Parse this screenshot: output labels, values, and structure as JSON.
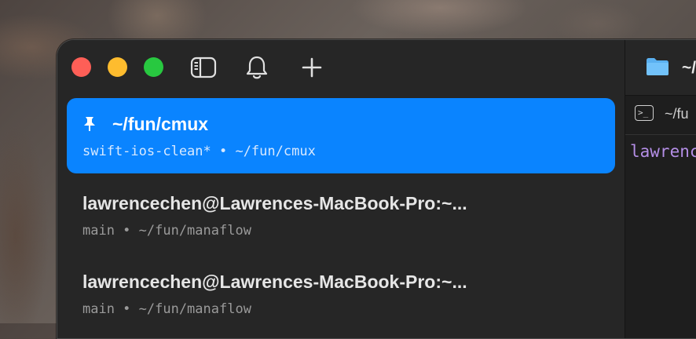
{
  "window": {
    "traffic_lights": [
      "close",
      "minimize",
      "maximize"
    ],
    "toolbar": {
      "icons": [
        "sidebar-toggle-icon",
        "bell-icon",
        "plus-icon"
      ]
    }
  },
  "sidebar": {
    "items": [
      {
        "title": "~/fun/cmux",
        "subtitle": "swift-ios-clean* • ~/fun/cmux",
        "pinned": true,
        "active": true
      },
      {
        "title": "lawrencechen@Lawrences-MacBook-Pro:~...",
        "subtitle": "main • ~/fun/manaflow",
        "pinned": false,
        "active": false
      },
      {
        "title": "lawrencechen@Lawrences-MacBook-Pro:~...",
        "subtitle": "main • ~/fun/manaflow",
        "pinned": false,
        "active": false
      }
    ]
  },
  "content": {
    "tab_title": "~/",
    "subbar_path": "~/fu",
    "prompt_text": "lawrenc"
  },
  "colors": {
    "accent": "#0a84ff",
    "close": "#fe5f57",
    "minimize": "#febc2e",
    "maximize": "#28c840",
    "prompt": "#b48ee6"
  }
}
